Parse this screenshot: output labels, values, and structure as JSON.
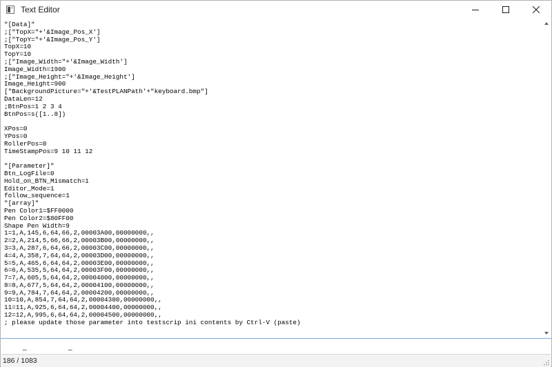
{
  "window": {
    "title": "Text Editor",
    "icon": "notepad-icon",
    "controls": [
      "minimize-icon",
      "maximize-icon",
      "close-icon"
    ]
  },
  "editor": {
    "lines": [
      "\"[Data]\"",
      ";[\"TopX=\"+'&Image_Pos_X']",
      ";[\"TopY=\"+'&Image_Pos_Y']",
      "TopX=10",
      "TopY=10",
      ";[\"Image_Width=\"+'&Image_Width']",
      "Image_Width=1900",
      ";[\"Image_Height=\"+'&Image_Height']",
      "Image_Height=900",
      "[\"BackgroundPicture=\"+'&TestPLANPath'+\"keyboard.bmp\"]",
      "DataLen=12",
      ";BtnPos=1 2 3 4",
      "BtnPos=s([1..8])",
      "",
      "XPos=0",
      "YPos=0",
      "RollerPos=0",
      "TimeStampPos=9 10 11 12",
      "",
      "\"[Parameter]\"",
      "Btn_LogFile=0",
      "Hold_on_BTN_Mismatch=1",
      "Editor_Mode=1",
      "follow_sequence=1",
      "\"[array]\"",
      "Pen Color1=$FF0000",
      "Pen Color2=$80FF00",
      "Shape Pen Width=9",
      "1=1,A,145,6,64,66,2,00003A00,00000000,,",
      "2=2,A,214,5,66,66,2,00003B00,00000000,,",
      "3=3,A,287,6,64,66,2,00003C00,00000000,,",
      "4=4,A,358,7,64,64,2,00003D00,00000000,,",
      "5=5,A,465,6,64,64,2,00003E00,00000000,,",
      "6=6,A,535,5,64,64,2,00003F00,00000000,,",
      "7=7,A,605,5,64,64,2,00004000,00000000,,",
      "8=8,A,677,5,64,64,2,00004100,00000000,,",
      "9=9,A,784,7,64,64,2,00004200,00000000,,",
      "10=10,A,854,7,64,64,2,00004300,00000000,,",
      "11=11,A,925,6,64,64,2,00004400,00000000,,",
      "12=12,A,995,6,64,64,2,00004500,00000000,,",
      "; please update those parameter into testscrip ini contents by Ctrl-V (paste)"
    ]
  },
  "bottom_pane": {
    "dash_1": "_",
    "dash_2": "_"
  },
  "statusbar": {
    "position": "186 / 1083"
  },
  "colors": {
    "separator": "#7aa7d9",
    "statusbar_bg": "#f3f3f3"
  }
}
